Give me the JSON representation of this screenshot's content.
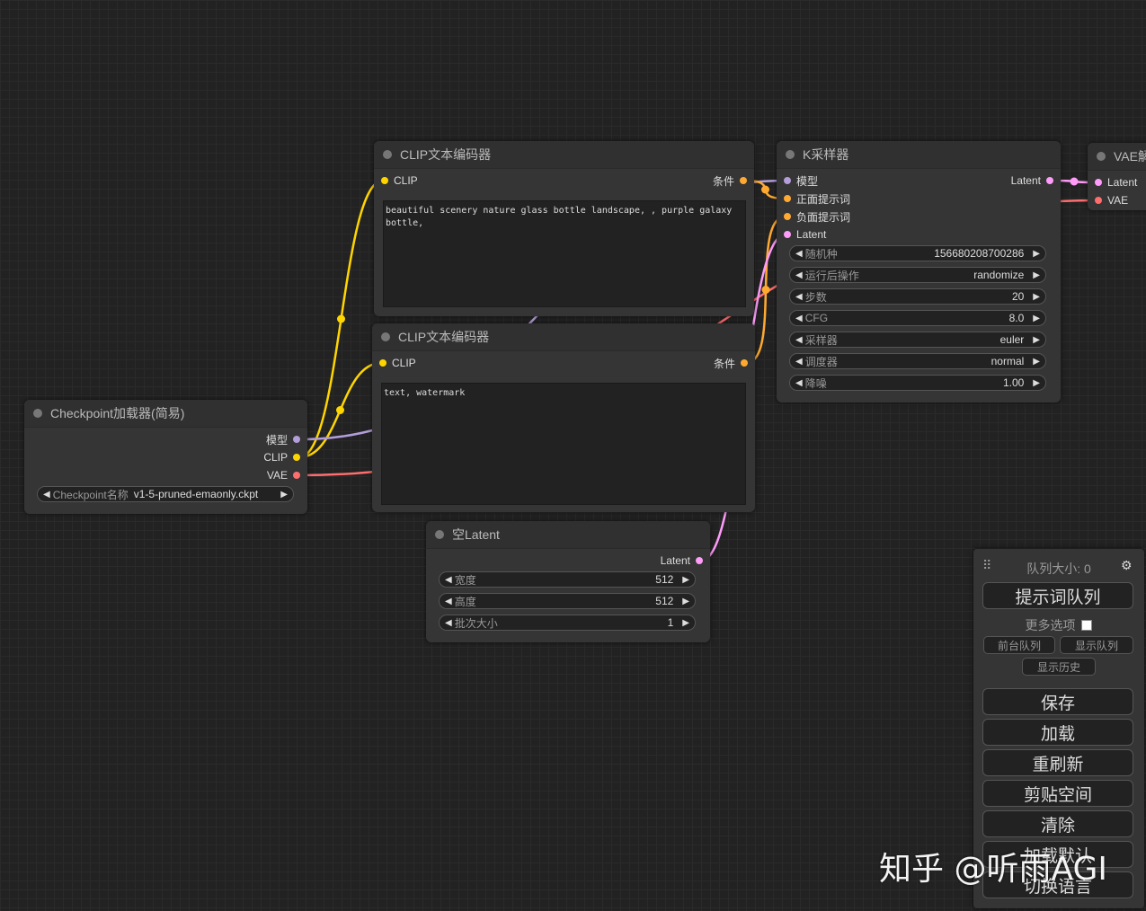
{
  "colors": {
    "background": "#222222",
    "clip_wire": "#FFD500",
    "model_wire": "#B39DDB",
    "vae_wire": "#FF6E6E",
    "latent_wire": "#FF9CF9",
    "conditioning_wire": "#FFA931"
  },
  "nodes": {
    "clip_pos": {
      "title": "CLIP文本编码器",
      "input_clip": "CLIP",
      "output_cond": "条件",
      "text": "beautiful scenery nature glass bottle landscape, , purple galaxy bottle,"
    },
    "clip_neg": {
      "title": "CLIP文本编码器",
      "input_clip": "CLIP",
      "output_cond": "条件",
      "text": "text, watermark"
    },
    "ksampler": {
      "title": "K采样器",
      "inputs": [
        "模型",
        "正面提示词",
        "负面提示词",
        "Latent"
      ],
      "output_latent": "Latent",
      "widgets": [
        {
          "label": "随机种",
          "value": "156680208700286"
        },
        {
          "label": "运行后操作",
          "value": "randomize"
        },
        {
          "label": "步数",
          "value": "20"
        },
        {
          "label": "CFG",
          "value": "8.0"
        },
        {
          "label": "采样器",
          "value": "euler"
        },
        {
          "label": "调度器",
          "value": "normal"
        },
        {
          "label": "降噪",
          "value": "1.00"
        }
      ]
    },
    "vae_decode": {
      "title": "VAE解",
      "inputs": [
        "Latent",
        "VAE"
      ]
    },
    "checkpoint": {
      "title": "Checkpoint加载器(简易)",
      "outputs": [
        "模型",
        "CLIP",
        "VAE"
      ],
      "widget_label": "Checkpoint名称",
      "widget_value": "v1-5-pruned-emaonly.ckpt"
    },
    "empty_latent": {
      "title": "空Latent",
      "output_latent": "Latent",
      "widgets": [
        {
          "label": "宽度",
          "value": "512"
        },
        {
          "label": "高度",
          "value": "512"
        },
        {
          "label": "批次大小",
          "value": "1"
        }
      ]
    }
  },
  "panel": {
    "queue_size": "队列大小: 0",
    "queue_prompt": "提示词队列",
    "more_options": "更多选项",
    "front_queue": "前台队列",
    "show_queue": "显示队列",
    "show_history": "显示历史",
    "save": "保存",
    "load": "加载",
    "refresh": "重刷新",
    "clipspace": "剪贴空间",
    "clear": "清除",
    "load_default": "加载默认",
    "switch_language": "切换语言"
  },
  "watermark": "知乎 @听雨AGI"
}
